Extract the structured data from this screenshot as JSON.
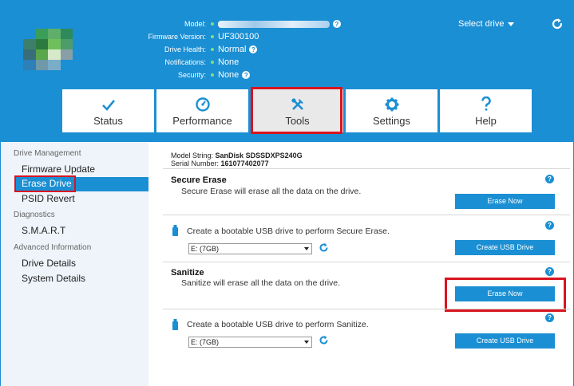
{
  "colors": {
    "brand": "#1b8fd3",
    "highlight": "#d9141f",
    "status_dot": "#7fe07f",
    "sidebar_bg": "#eef4fa"
  },
  "header": {
    "info": [
      {
        "label": "Model:",
        "value": ""
      },
      {
        "label": "Firmware Version:",
        "value": "UF300100"
      },
      {
        "label": "Drive Health:",
        "value": "Normal"
      },
      {
        "label": "Notifications:",
        "value": "None"
      },
      {
        "label": "Security:",
        "value": "None"
      }
    ],
    "select_drive": "Select drive"
  },
  "tabs": [
    {
      "label": "Status",
      "icon": "check-icon"
    },
    {
      "label": "Performance",
      "icon": "speedometer-icon"
    },
    {
      "label": "Tools",
      "icon": "tools-icon"
    },
    {
      "label": "Settings",
      "icon": "gear-icon"
    },
    {
      "label": "Help",
      "icon": "question-icon"
    }
  ],
  "sidebar": {
    "drive_management": "Drive Management",
    "firmware_update": "Firmware Update",
    "erase_drive": "Erase Drive",
    "psid_revert": "PSID Revert",
    "diagnostics": "Diagnostics",
    "smart": "S.M.A.R.T",
    "advanced_information": "Advanced Information",
    "drive_details": "Drive Details",
    "system_details": "System Details"
  },
  "content": {
    "model_string_label": "Model String:",
    "model_string_value": "SanDisk SDSSDXPS240G",
    "serial_number_label": "Serial Number:",
    "serial_number_value": "161077402077",
    "secure_erase": {
      "title": "Secure Erase",
      "desc": "Secure Erase will erase all the data on the drive.",
      "button": "Erase Now"
    },
    "usb_secure_erase": {
      "text": "Create a bootable USB drive to perform Secure Erase.",
      "drive": "E: (7GB)",
      "button": "Create USB Drive"
    },
    "sanitize": {
      "title": "Sanitize",
      "desc": "Sanitize will erase all the data on the drive.",
      "button": "Erase Now"
    },
    "usb_sanitize": {
      "text": "Create a bootable USB drive to perform Sanitize.",
      "drive": "E: (7GB)",
      "button": "Create USB Drive"
    }
  }
}
